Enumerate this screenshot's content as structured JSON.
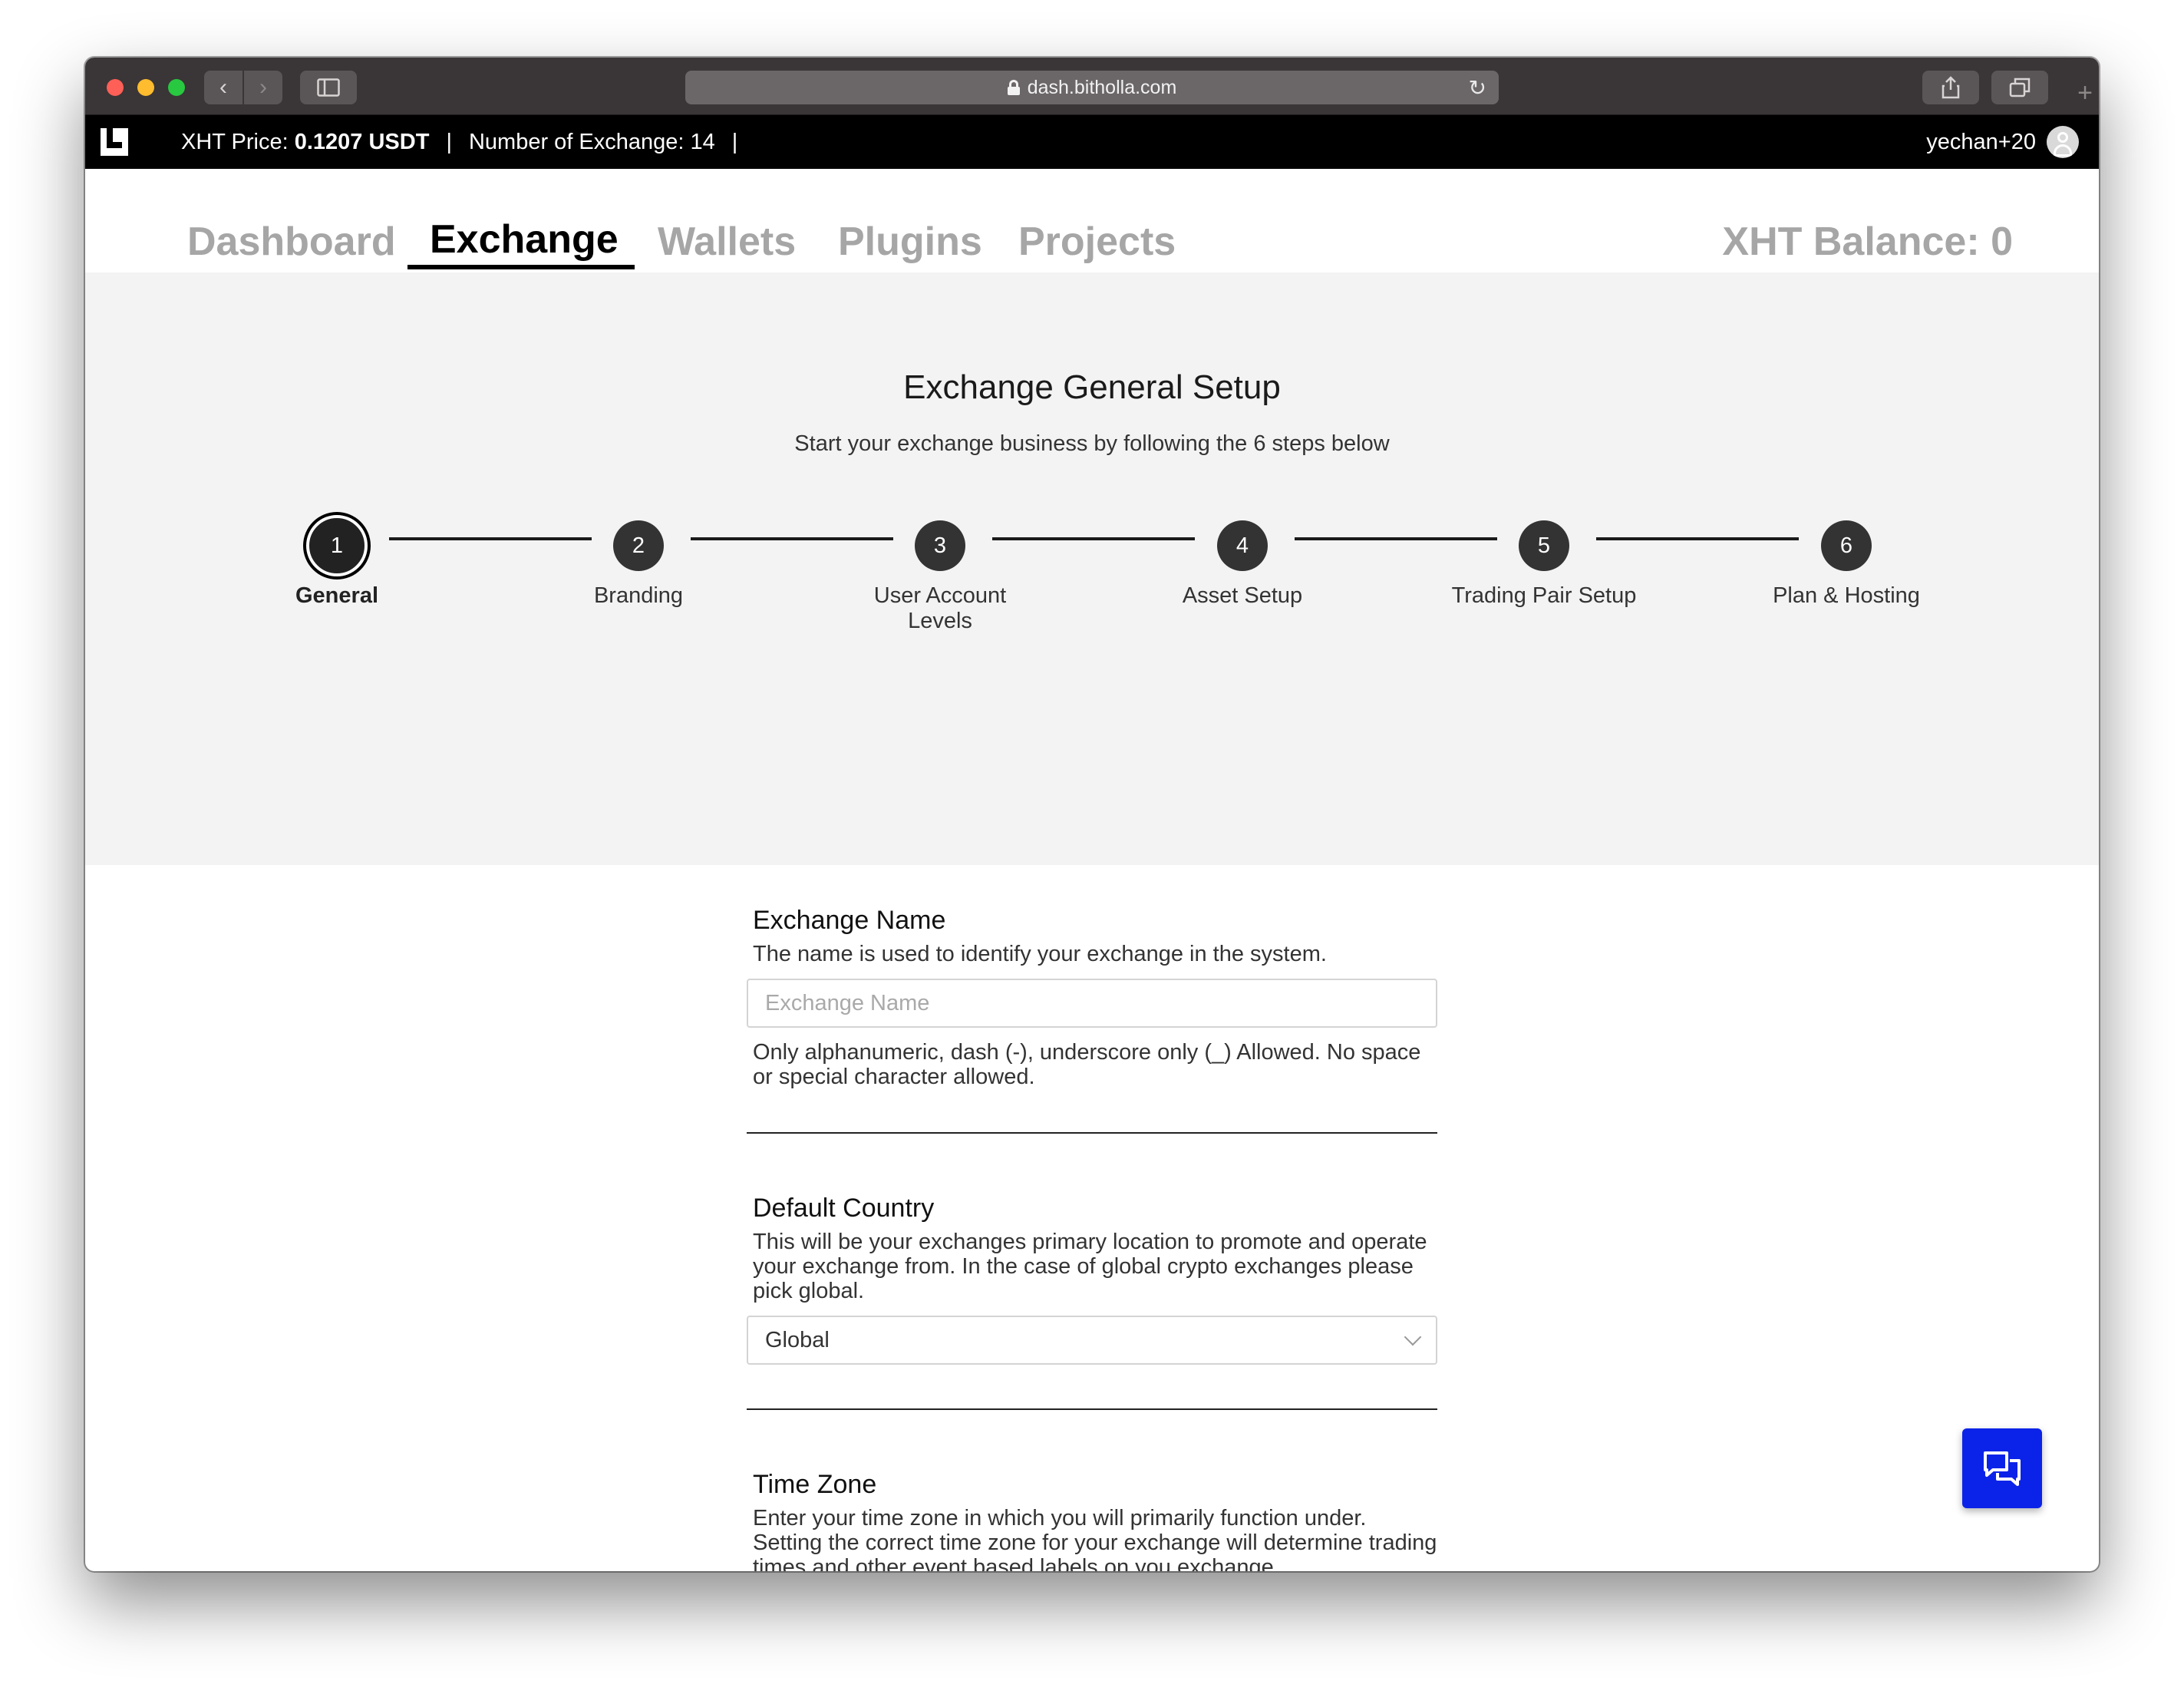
{
  "browser": {
    "url": "dash.bitholla.com"
  },
  "appbar": {
    "xht_price_label": "XHT Price:",
    "xht_price_value": "0.1207 USDT",
    "separator": "|",
    "exchange_count": "Number of Exchange: 14",
    "username": "yechan+20"
  },
  "nav": {
    "tabs": [
      "Dashboard",
      "Exchange",
      "Wallets",
      "Plugins",
      "Projects"
    ],
    "active_tab": "Exchange",
    "balance": "XHT Balance: 0"
  },
  "setup": {
    "title": "Exchange General Setup",
    "subtitle": "Start your exchange business by following the 6 steps below",
    "steps": [
      {
        "num": "1",
        "label": "General"
      },
      {
        "num": "2",
        "label": "Branding"
      },
      {
        "num": "3",
        "label": "User Account Levels"
      },
      {
        "num": "4",
        "label": "Asset Setup"
      },
      {
        "num": "5",
        "label": "Trading Pair Setup"
      },
      {
        "num": "6",
        "label": "Plan & Hosting"
      }
    ],
    "active_step": 1
  },
  "form": {
    "exchange_name": {
      "title": "Exchange Name",
      "desc": "The name is used to identify your exchange in the system.",
      "placeholder": "Exchange Name",
      "hint": "Only alphanumeric, dash (-), underscore only (_) Allowed. No space or special character allowed."
    },
    "default_country": {
      "title": "Default Country",
      "desc": "This will be your exchanges primary location to promote and operate your exchange from. In the case of global crypto exchanges please pick global.",
      "value": "Global"
    },
    "time_zone": {
      "title": "Time Zone",
      "desc": "Enter your time zone in which you will primarily function under. Setting the correct time zone for your exchange will determine trading times and other event based labels on you exchange."
    }
  },
  "colors": {
    "chat_button": "#0b23e8",
    "band_bg": "#f3f3f3"
  }
}
